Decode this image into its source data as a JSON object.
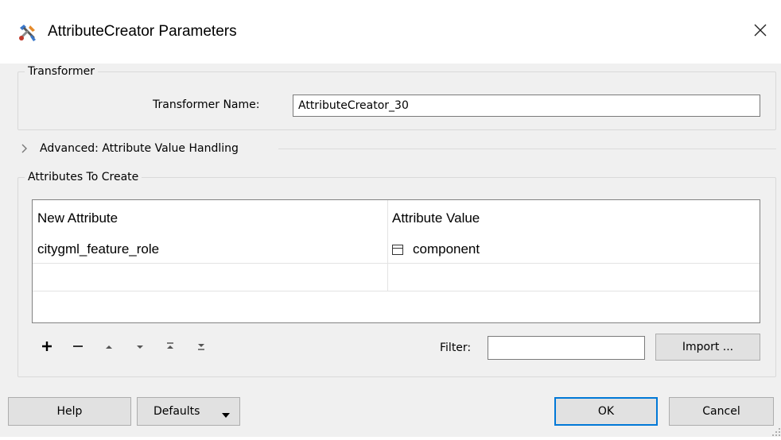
{
  "window": {
    "title": "AttributeCreator Parameters",
    "app_icon": "fme-transformer-icon",
    "close_icon": "close-icon"
  },
  "transformer_group": {
    "legend": "Transformer",
    "name_label": "Transformer Name:",
    "name_value": "AttributeCreator_30"
  },
  "advanced": {
    "label": "Advanced: Attribute Value Handling",
    "expand_icon": "chevron-right-icon"
  },
  "attributes_group": {
    "legend": "Attributes To Create",
    "columns": [
      "New Attribute",
      "Attribute Value"
    ],
    "rows": [
      {
        "attribute": "citygml_feature_role",
        "value": "component"
      },
      {
        "attribute": "",
        "value": ""
      }
    ],
    "value_icon": "text-value-icon",
    "toolbar": [
      "add-icon",
      "remove-icon",
      "move-up-icon",
      "move-down-icon",
      "move-top-icon",
      "move-bottom-icon"
    ],
    "filter_label": "Filter:",
    "filter_value": "",
    "import_label": "Import ..."
  },
  "footer": {
    "help_label": "Help",
    "defaults_label": "Defaults",
    "ok_label": "OK",
    "cancel_label": "Cancel"
  },
  "colors": {
    "dialog_bg": "#f0f0f0",
    "title_bg": "#ffffff",
    "button_bg": "#e1e1e1",
    "accent": "#0078d7"
  }
}
